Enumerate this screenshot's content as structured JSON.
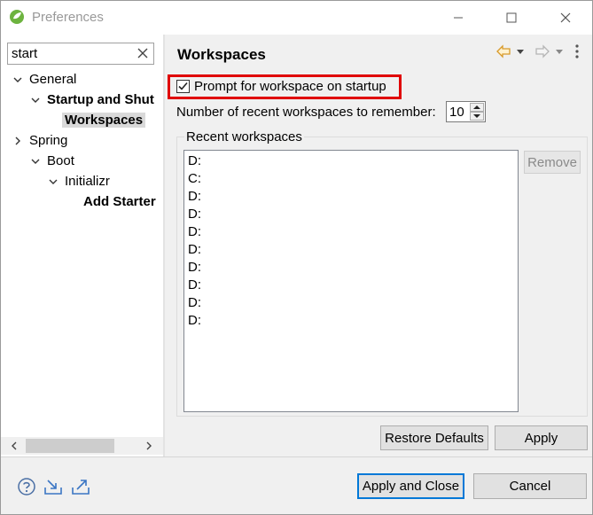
{
  "window": {
    "title": "Preferences"
  },
  "filter": {
    "value": "start"
  },
  "tree": {
    "items": [
      {
        "label": "General"
      },
      {
        "label": "Startup and Shut"
      },
      {
        "label": "Workspaces"
      },
      {
        "label": "Spring"
      },
      {
        "label": "Boot"
      },
      {
        "label": "Initializr"
      },
      {
        "label": "Add Starter"
      }
    ]
  },
  "page": {
    "title": "Workspaces",
    "prompt_label": "Prompt for workspace on startup",
    "prompt_checked": true,
    "recent_count_label": "Number of recent workspaces to remember:",
    "recent_count_value": "10",
    "recent_group_label": "Recent workspaces",
    "recent_items": [
      "D:",
      "C:",
      "D:",
      "D:",
      "D:",
      "D:",
      "D:",
      "D:",
      "D:",
      "D:"
    ],
    "remove_label": "Remove",
    "restore_defaults_label": "Restore Defaults",
    "apply_label": "Apply"
  },
  "footer": {
    "apply_close_label": "Apply and Close",
    "cancel_label": "Cancel"
  },
  "colors": {
    "highlight": "#e00000",
    "accent": "#0078d7",
    "nav_arrow": "#e0a030"
  },
  "icons": [
    "app-icon",
    "minimize-icon",
    "maximize-icon",
    "close-icon",
    "clear-filter-icon",
    "back-arrow-icon",
    "forward-arrow-icon",
    "menu-icon",
    "help-icon",
    "import-icon",
    "export-icon"
  ]
}
